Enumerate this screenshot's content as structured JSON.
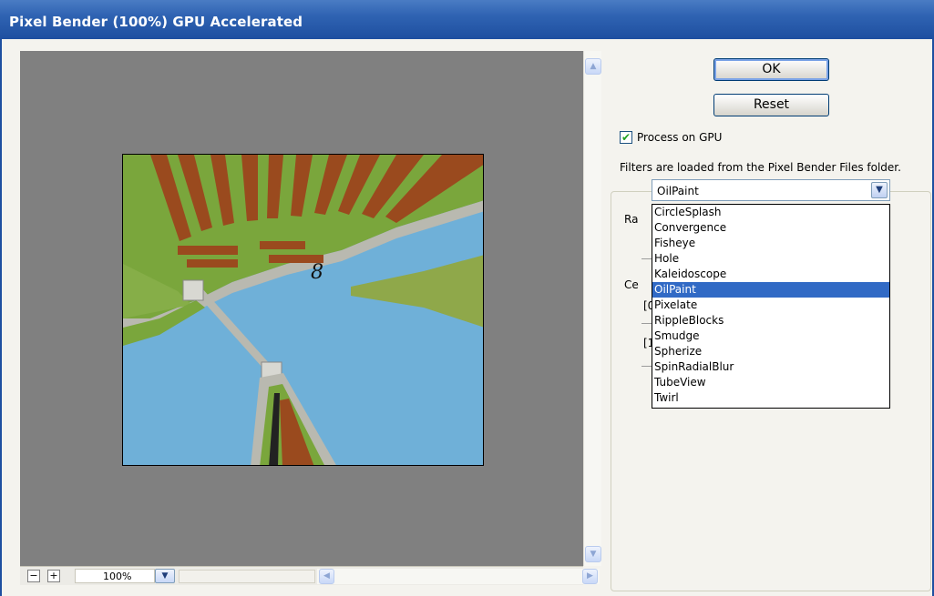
{
  "window": {
    "title": "Pixel Bender (100%) GPU Accelerated"
  },
  "buttons": {
    "ok_label": "OK",
    "reset_label": "Reset"
  },
  "gpu": {
    "label": "Process on GPU",
    "checked": true
  },
  "info_text": "Filters are loaded from the Pixel Bender Files folder.",
  "filter_select": {
    "selected": "OilPaint",
    "options": [
      "CircleSplash",
      "Convergence",
      "Fisheye",
      "Hole",
      "Kaleidoscope",
      "OilPaint",
      "Pixelate",
      "RippleBlocks",
      "Smudge",
      "Spherize",
      "SpinRadialBlur",
      "TubeView",
      "Twirl"
    ]
  },
  "params": {
    "frag1": "Ra",
    "frag2": "Ce",
    "frag3": "[0",
    "frag4": "[1"
  },
  "preview": {
    "image_label": "8"
  },
  "zoom": {
    "minus": "−",
    "plus": "+",
    "value": "100%"
  },
  "colors": {
    "titlebar": "#2f63b2",
    "preview_bg": "#808080",
    "selection": "#316ac5",
    "water": "#6fb0d8",
    "grass": "#7aa63c",
    "roof": "#9a4a1e"
  }
}
